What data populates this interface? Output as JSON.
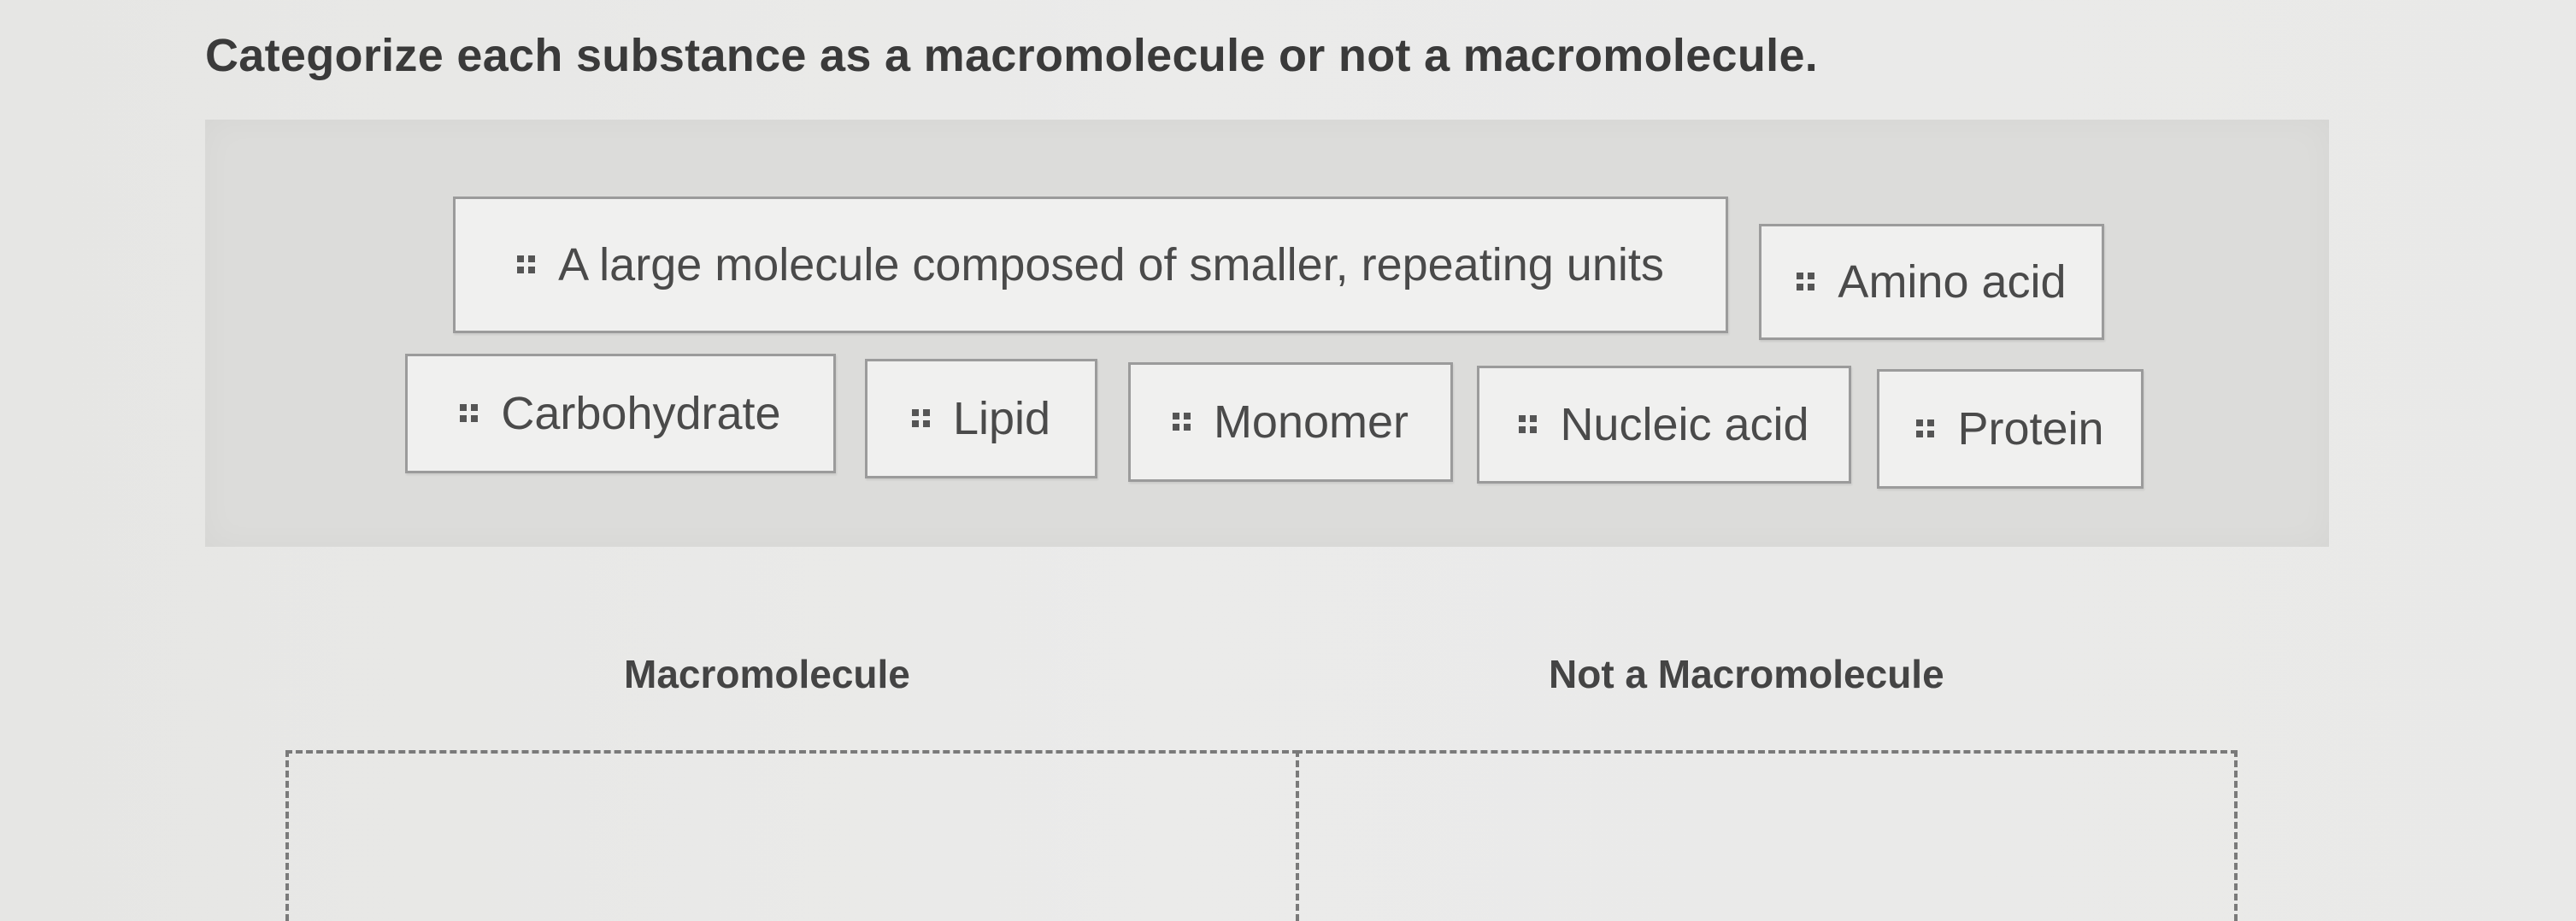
{
  "question": "Categorize each substance as a macromolecule or not a macromolecule.",
  "items": [
    {
      "label": "A large molecule composed of smaller, repeating units"
    },
    {
      "label": "Amino acid"
    },
    {
      "label": "Carbohydrate"
    },
    {
      "label": "Lipid"
    },
    {
      "label": "Monomer"
    },
    {
      "label": "Nucleic acid"
    },
    {
      "label": "Protein"
    }
  ],
  "categories": {
    "macromolecule": "Macromolecule",
    "not_macromolecule": "Not a Macromolecule"
  },
  "icons": {
    "drag_handle": "grip-dots-icon"
  }
}
